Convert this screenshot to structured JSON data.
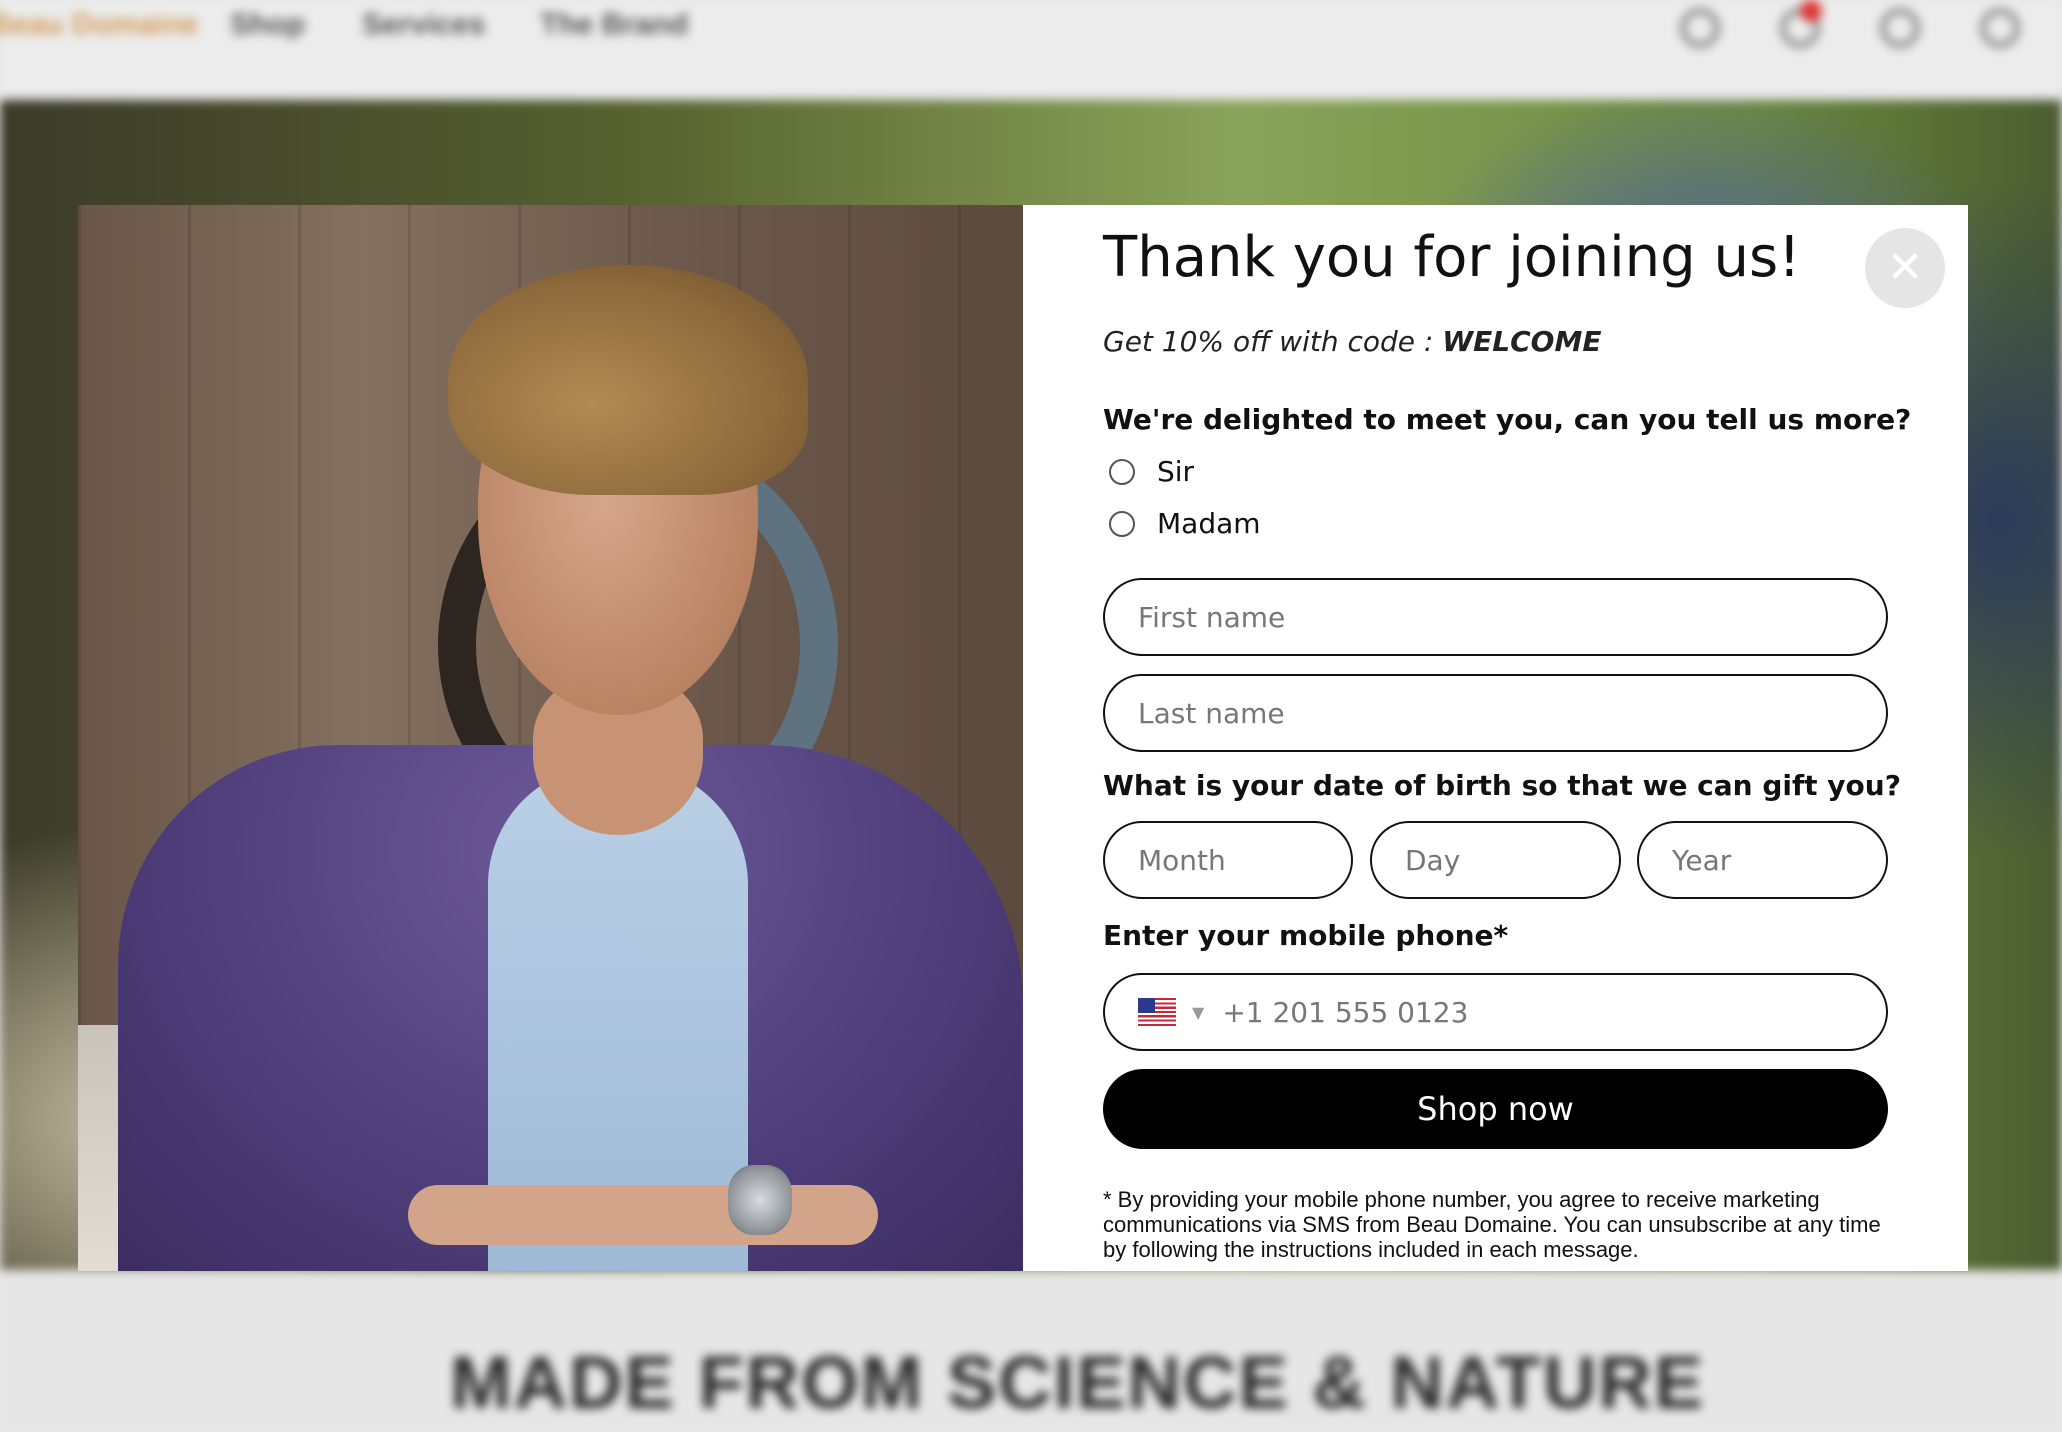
{
  "background": {
    "brand": "Beau Domaine",
    "nav": [
      "Shop",
      "Services",
      "The Brand"
    ],
    "tagline": "MADE FROM SCIENCE & NATURE",
    "icons": [
      "search-icon",
      "bell-icon",
      "account-icon",
      "cart-icon"
    ]
  },
  "modal": {
    "close_label": "✕",
    "title": "Thank you for joining us!",
    "promo_text": "Get 10% off with code : ",
    "promo_code": "WELCOME",
    "question_salutation": "We're delighted to meet you, can you tell us more?",
    "salutation_options": [
      "Sir",
      "Madam"
    ],
    "first_name_placeholder": "First name",
    "last_name_placeholder": "Last name",
    "question_dob": "What is your date of birth so that we can gift you?",
    "dob_placeholders": {
      "month": "Month",
      "day": "Day",
      "year": "Year"
    },
    "phone_label": "Enter your mobile phone*",
    "phone_country": "us-flag-icon",
    "phone_placeholder": "+1 201 555 0123",
    "submit_label": "Shop now",
    "disclaimer": "* By providing your mobile phone number, you agree to receive marketing communications via SMS from Beau Domaine. You can unsubscribe at any time by following the instructions included in each message."
  },
  "colors": {
    "button_bg": "#000000",
    "field_border": "#111111",
    "close_bg": "#e5e5e5"
  }
}
